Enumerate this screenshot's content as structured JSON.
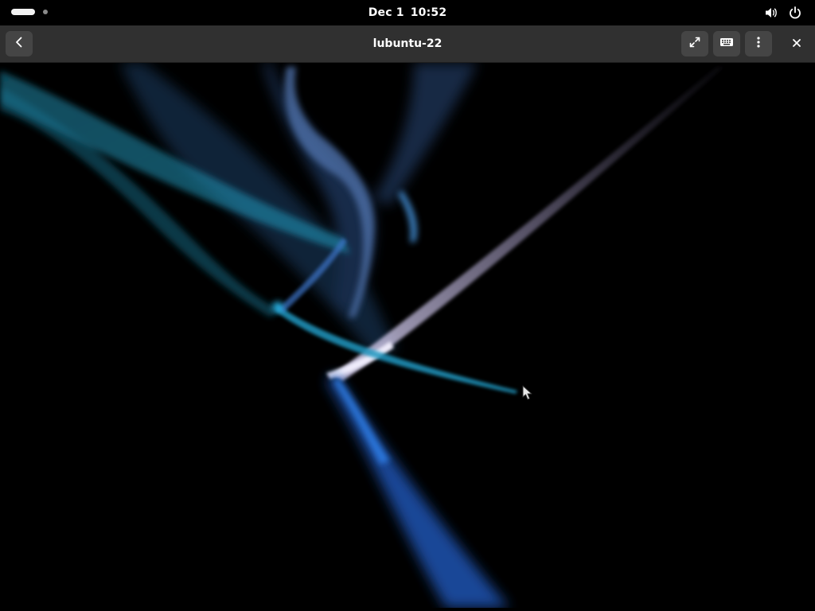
{
  "topbar": {
    "date": "Dec 1",
    "time": "10:52",
    "icons": [
      "volume-icon",
      "power-icon"
    ]
  },
  "window": {
    "title": "lubuntu-22",
    "buttons": {
      "back": "back-icon",
      "fullscreen": "fullscreen-icon",
      "keyboard": "keyboard-icon",
      "menu": "menu-icon",
      "close": "close-icon"
    }
  },
  "remote_desktop": {
    "content": "screensaver-wallpaper",
    "colors": {
      "background": "#000000",
      "glow_cyan": "#1fa3c9",
      "glow_blue": "#2b6fe0",
      "glow_lilac": "#b3a8d6"
    }
  }
}
